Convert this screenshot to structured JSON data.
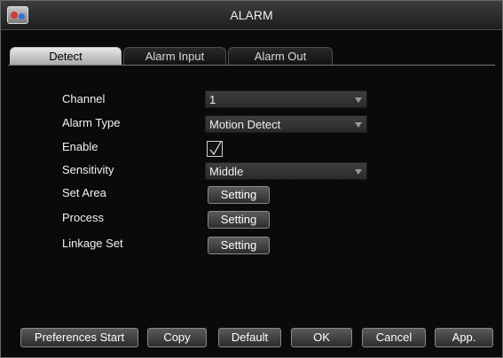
{
  "window": {
    "title": "ALARM"
  },
  "tabs": [
    {
      "label": "Detect",
      "active": true
    },
    {
      "label": "Alarm Input",
      "active": false
    },
    {
      "label": "Alarm Out",
      "active": false
    }
  ],
  "form": {
    "channel": {
      "label": "Channel",
      "value": "1"
    },
    "alarm_type": {
      "label": "Alarm Type",
      "value": "Motion Detect"
    },
    "enable": {
      "label": "Enable",
      "checked": true
    },
    "sensitivity": {
      "label": "Sensitivity",
      "value": "Middle"
    },
    "set_area": {
      "label": "Set Area",
      "button": "Setting"
    },
    "process": {
      "label": "Process",
      "button": "Setting"
    },
    "linkage_set": {
      "label": "Linkage Set",
      "button": "Setting"
    }
  },
  "footer": {
    "preferences_start": "Preferences Start",
    "copy": "Copy",
    "default": "Default",
    "ok": "OK",
    "cancel": "Cancel",
    "apply": "App."
  },
  "icons": {
    "app_logo": "app-logo-icon",
    "dropdown_arrow": "chevron-down-icon",
    "check": "checkmark-icon"
  }
}
